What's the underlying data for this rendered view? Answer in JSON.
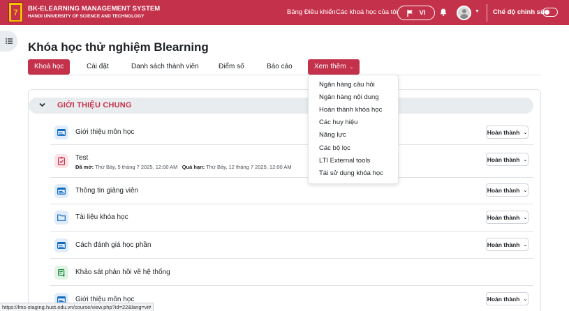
{
  "header": {
    "brand_title": "BK-ELEARNING MANAGEMENT SYSTEM",
    "brand_subtitle": "HANOI UNIVERSITY OF SCIENCE AND TECHNOLOGY",
    "logo_glyph": "7",
    "dashboard_link": "Bảng Điều khiển",
    "my_courses_link": "Các khoá học của tôi",
    "language": "VI",
    "edit_mode_label": "Chế độ chỉnh sửa",
    "brand_color": "#c4314b"
  },
  "course": {
    "title": "Khóa học thử nghiệm Blearning",
    "tabs": [
      "Khoá học",
      "Cài đặt",
      "Danh sách thành viên",
      "Điểm số",
      "Báo cáo",
      "Xem thêm"
    ]
  },
  "more_menu": {
    "items": [
      "Ngân hàng câu hỏi",
      "Ngân hàng nội dung",
      "Hoàn thành khóa học",
      "Các huy hiệu",
      "Năng lực",
      "Các bộ lọc",
      "LTI External tools",
      "Tái sử dụng khóa học"
    ]
  },
  "section": {
    "title": "GIỚI THIỆU CHUNG",
    "activities": [
      {
        "name": "Giới thiệu môn học",
        "icon": "page-icon",
        "completion": "Hoàn thành"
      },
      {
        "name": "Test",
        "icon": "quiz-icon",
        "completion": "Hoàn thành",
        "open_label": "Đã mở:",
        "open_value": "Thứ Bảy, 5 tháng 7 2025, 12:00 AM",
        "due_label": "Quá hạn:",
        "due_value": "Thứ Bảy, 12 tháng 7 2025, 12:00 AM"
      },
      {
        "name": "Thông tin giảng viên",
        "icon": "page-icon",
        "completion": "Hoàn thành"
      },
      {
        "name": "Tài liệu khóa học",
        "icon": "folder-icon",
        "completion": "Hoàn thành"
      },
      {
        "name": "Cách đánh giá học phần",
        "icon": "page-icon",
        "completion": "Hoàn thành"
      },
      {
        "name": "Khảo sát phản hồi về hệ thống",
        "icon": "feedback-icon",
        "completion": ""
      },
      {
        "name": "Giới thiệu môn học",
        "icon": "page-icon",
        "completion": "Hoàn thành"
      }
    ]
  },
  "status_url": "https://lms-staging.hust.edu.vn/course/view.php?id=22&lang=vi#"
}
